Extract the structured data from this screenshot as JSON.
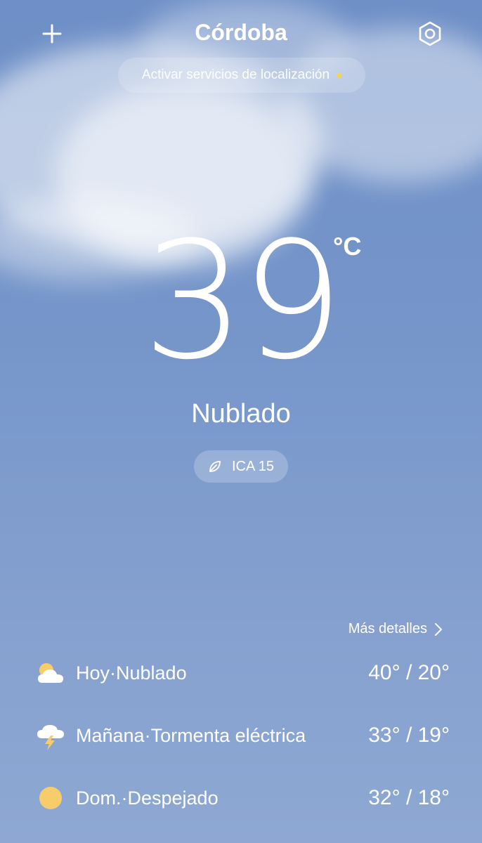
{
  "header": {
    "city": "Córdoba",
    "add_icon": "plus-icon",
    "settings_icon": "settings-hexagon-icon"
  },
  "location_prompt": {
    "text": "Activar servicios de localización",
    "dot_color": "#f7d54a"
  },
  "current": {
    "temperature": "39",
    "unit": "°C",
    "condition": "Nublado",
    "aqi_label": "ICA 15",
    "aqi_icon": "leaf-icon"
  },
  "forecast": {
    "more_label": "Más detalles",
    "days": [
      {
        "label": "Hoy·Nublado",
        "temps": "40° / 20°",
        "icon": "cloudy-sun-icon"
      },
      {
        "label": "Mañana·Tormenta eléctrica",
        "temps": "33° / 19°",
        "icon": "thunderstorm-icon"
      },
      {
        "label": "Dom.·Despejado",
        "temps": "32° / 18°",
        "icon": "sun-icon"
      }
    ]
  },
  "colors": {
    "sky_top": "#6e8fc7",
    "sky_bottom": "#8ea8d3",
    "sun": "#f7cd6b"
  }
}
